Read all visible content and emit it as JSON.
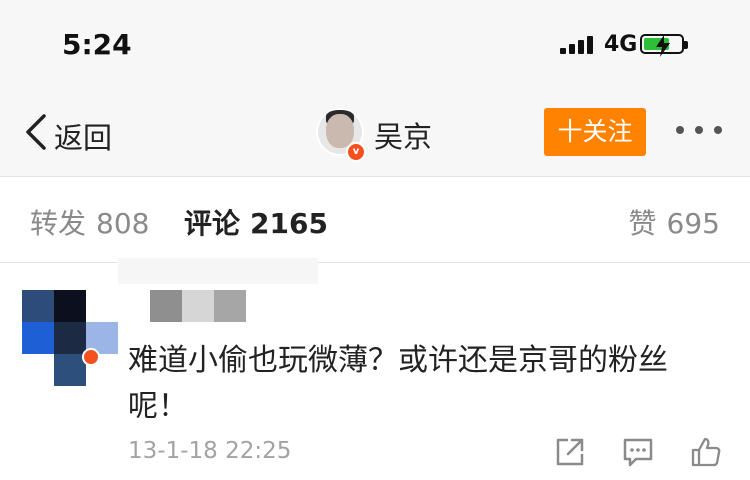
{
  "status_bar": {
    "time": "5:24",
    "network": "4G",
    "signal_bars": 4,
    "battery_level": 0.7,
    "charging": true
  },
  "nav": {
    "back_label": "返回",
    "profile_name": "吴京",
    "verified_badge": "v",
    "follow_label": "十关注",
    "more_icon": "more-dots-icon"
  },
  "tabs": [
    {
      "label": "转发",
      "count": "808",
      "active": false
    },
    {
      "label": "评论",
      "count": "2165",
      "active": true
    },
    {
      "label": "赞",
      "count": "695",
      "active": false
    }
  ],
  "comment": {
    "text": "难道小偷也玩微薄？或许还是京哥的粉丝呢！",
    "timestamp": "13-1-18 22:25",
    "actions": [
      "share-icon",
      "reply-icon",
      "like-icon"
    ]
  },
  "colors": {
    "accent": "#ff8200",
    "battery_green": "#2fbe3a",
    "verified": "#f4511e",
    "muted_text": "#a3a3a3"
  }
}
